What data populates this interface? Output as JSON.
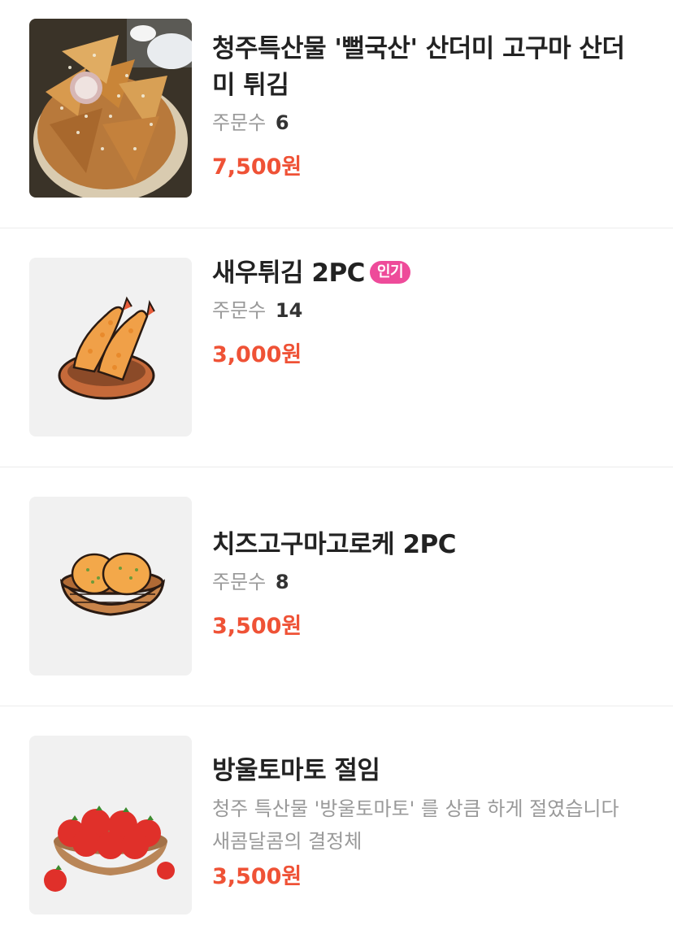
{
  "menu_items": [
    {
      "name": "청주특산물 '뻘국산' 산더미 고구마 산더미 튀김",
      "orders_label": "주문수",
      "orders_count": "6",
      "price": "7,500원",
      "image": "fried-sweet-potato-photo"
    },
    {
      "name": "새우튀김 2PC",
      "badge": "인기",
      "orders_label": "주문수",
      "orders_count": "14",
      "price": "3,000원",
      "image": "fried-shrimp-illustration"
    },
    {
      "name": "치즈고구마고로케 2PC",
      "orders_label": "주문수",
      "orders_count": "8",
      "price": "3,500원",
      "image": "croquette-illustration"
    },
    {
      "name": "방울토마토 절임",
      "description": "청주 특산물 '방울토마토' 를 상큼 하게 절였습니다 새콤달콤의 결정체",
      "price": "3,500원",
      "image": "cherry-tomato-illustration"
    }
  ],
  "colors": {
    "price": "#ef5236",
    "badge": "#ee4b9a",
    "thumb_bg": "#f1f1f1"
  }
}
